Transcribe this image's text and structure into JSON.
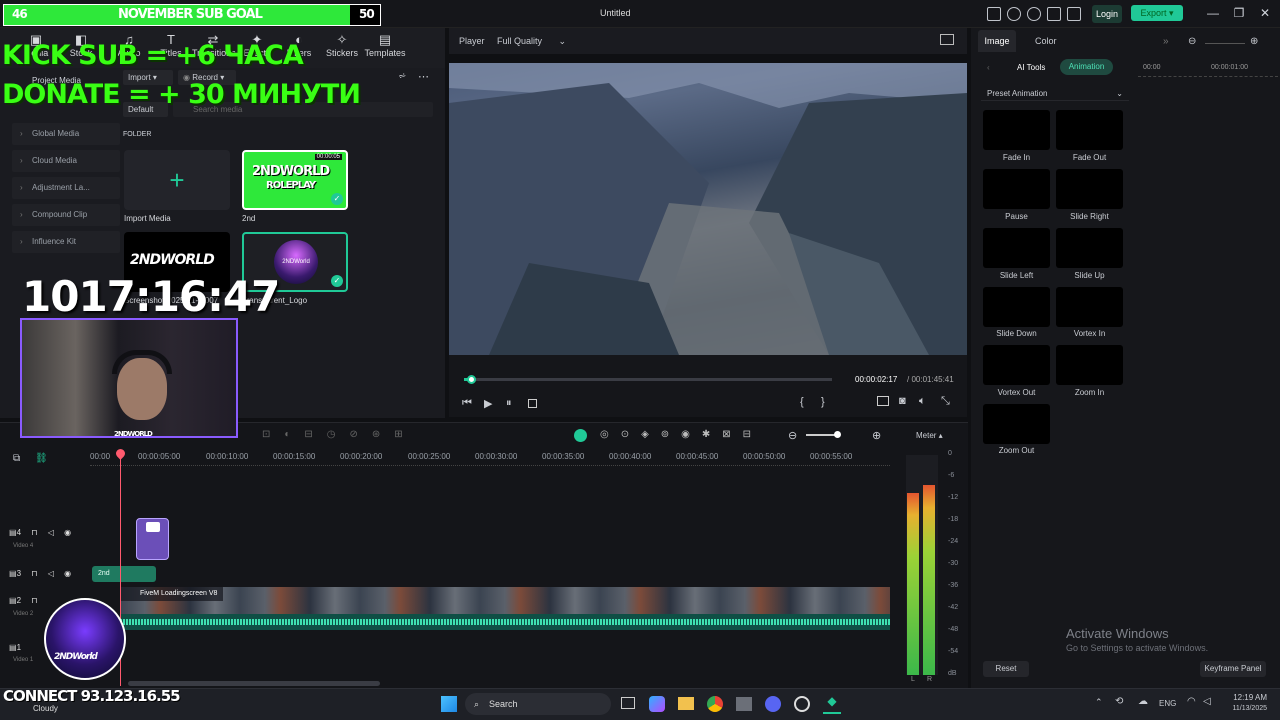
{
  "window": {
    "title": "Untitled",
    "login": "Login",
    "export": "Export"
  },
  "toolbar": {
    "tools": [
      "Media",
      "Stock",
      "Audio",
      "Titles",
      "Transitions",
      "Effects",
      "Filters",
      "Stickers",
      "Templates"
    ]
  },
  "media": {
    "project_media": "Project Media",
    "import": "Import",
    "record": "Record",
    "default": "Default",
    "search_placeholder": "Search media",
    "sidebar": [
      "Global Media",
      "Cloud Media",
      "Adjustment La...",
      "Compound Clip",
      "Influence Kit"
    ],
    "folder": "FOLDER",
    "items": [
      {
        "label": "Import Media"
      },
      {
        "label": "2nd",
        "duration": "00:00:05",
        "title_top": "2NDWORLD",
        "title_bottom": "ROLEPLAY"
      },
      {
        "label": "Screenshot 2025-11-...007",
        "title_top": "2NDWORLD"
      },
      {
        "label": "Transparent_Logo",
        "logo_text": "2NDWorld"
      }
    ]
  },
  "player": {
    "label": "Player",
    "quality": "Full Quality",
    "current_time": "00:00:02:17",
    "total_time": "/ 00:01:45:41",
    "progress_pct": 2
  },
  "right_panel": {
    "tabs": [
      "Image",
      "Color"
    ],
    "subtabs": [
      "AI Tools",
      "Animation"
    ],
    "time_start": "00:00",
    "time_end": "00:00:01:00",
    "preset_label": "Preset Animation",
    "presets": [
      "Fade In",
      "Fade Out",
      "Pause",
      "Slide Right",
      "Slide Left",
      "Slide Up",
      "Slide Down",
      "Vortex In",
      "Vortex Out",
      "Zoom In",
      "Zoom Out"
    ],
    "reset": "Reset",
    "keyframe_panel": "Keyframe Panel",
    "activate_title": "Activate Windows",
    "activate_sub": "Go to Settings to activate Windows."
  },
  "timeline": {
    "ticks": [
      "00:00",
      "00:00:05:00",
      "00:00:10:00",
      "00:00:15:00",
      "00:00:20:00",
      "00:00:25:00",
      "00:00:30:00",
      "00:00:35:00",
      "00:00:40:00",
      "00:00:45:00",
      "00:00:50:00",
      "00:00:55:00"
    ],
    "meter_label": "Meter",
    "tracks": [
      {
        "num": "4",
        "name": "Video 4"
      },
      {
        "num": "3",
        "name": ""
      },
      {
        "num": "2",
        "name": "Video 2"
      },
      {
        "num": "1",
        "name": "Video 1"
      }
    ],
    "clip_video": "FiveM Loadingscreen V8",
    "clip_title": "2nd",
    "meter_scale": [
      "0",
      "-6",
      "-12",
      "-18",
      "-24",
      "-30",
      "-36",
      "-42",
      "-48",
      "-54",
      "dB"
    ],
    "meter_lr": [
      "L",
      "R"
    ]
  },
  "taskbar": {
    "search": "Search",
    "lang": "ENG",
    "time": "12:19 AM",
    "date": "11/13/2025",
    "weather": "Cloudy"
  },
  "overlay": {
    "goal_left": "46",
    "goal_title": "NOVEMBER SUB GOAL",
    "goal_right": "50",
    "goal_progress_pct": 92,
    "line1": "KICK SUB = +6 ЧАСА",
    "line2": "DONATE = + 30 МИНУТИ",
    "timer": "1017:16:47",
    "connect": "CONNECT 93.123.16.55",
    "cam_caption": "2NDWORLD",
    "logo_text": "2NDWorld"
  },
  "colors": {
    "accent": "#20c997",
    "goal_green": "#2ee83a",
    "overlay_text": "#39ff14"
  }
}
